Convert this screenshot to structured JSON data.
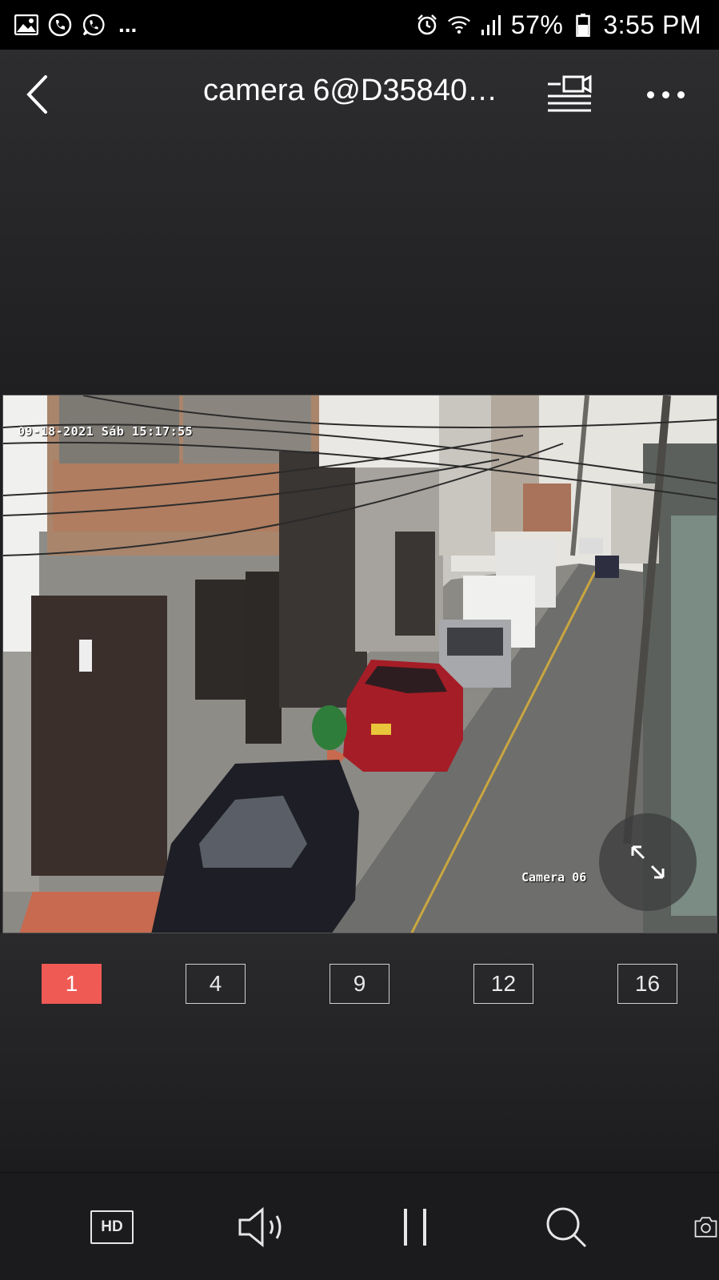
{
  "status_bar": {
    "battery": "57%",
    "time": "3:55 PM",
    "overflow": "..."
  },
  "header": {
    "title": "camera 6@D35840…"
  },
  "video": {
    "osd_timestamp": "09-18-2021 Sáb 15:17:55",
    "osd_camera": "Camera 06"
  },
  "layouts": [
    {
      "label": "1",
      "active": true
    },
    {
      "label": "4",
      "active": false
    },
    {
      "label": "9",
      "active": false
    },
    {
      "label": "12",
      "active": false
    },
    {
      "label": "16",
      "active": false
    }
  ],
  "toolbar": {
    "hd_label": "HD"
  },
  "colors": {
    "accent": "#f05a55",
    "background": "#1f1f21"
  }
}
